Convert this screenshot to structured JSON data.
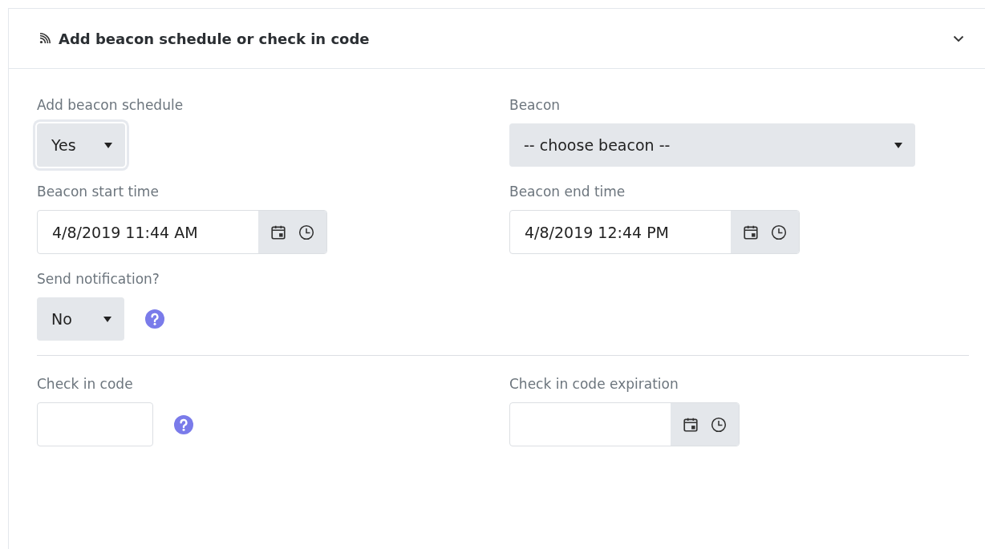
{
  "panel": {
    "title": "Add beacon schedule or check in code",
    "expanded": true
  },
  "sections": [
    {
      "rows": [
        [
          {
            "label": "Add beacon schedule",
            "kind": "select",
            "value": "Yes",
            "focused": true
          },
          {
            "label": "Beacon",
            "kind": "select",
            "value": "-- choose beacon --"
          }
        ],
        [
          {
            "label": "Beacon start time",
            "kind": "datetime",
            "value": "4/8/2019 11:44 AM"
          },
          {
            "label": "Beacon end time",
            "kind": "datetime",
            "value": "4/8/2019 12:44 PM"
          }
        ],
        [
          {
            "label": "Send notification?",
            "kind": "select",
            "value": "No",
            "help": true
          }
        ]
      ]
    },
    {
      "rows": [
        [
          {
            "label": "Check in code",
            "kind": "text",
            "help": true
          },
          {
            "label": "Check in code expiration",
            "kind": "datetime"
          }
        ]
      ]
    }
  ]
}
